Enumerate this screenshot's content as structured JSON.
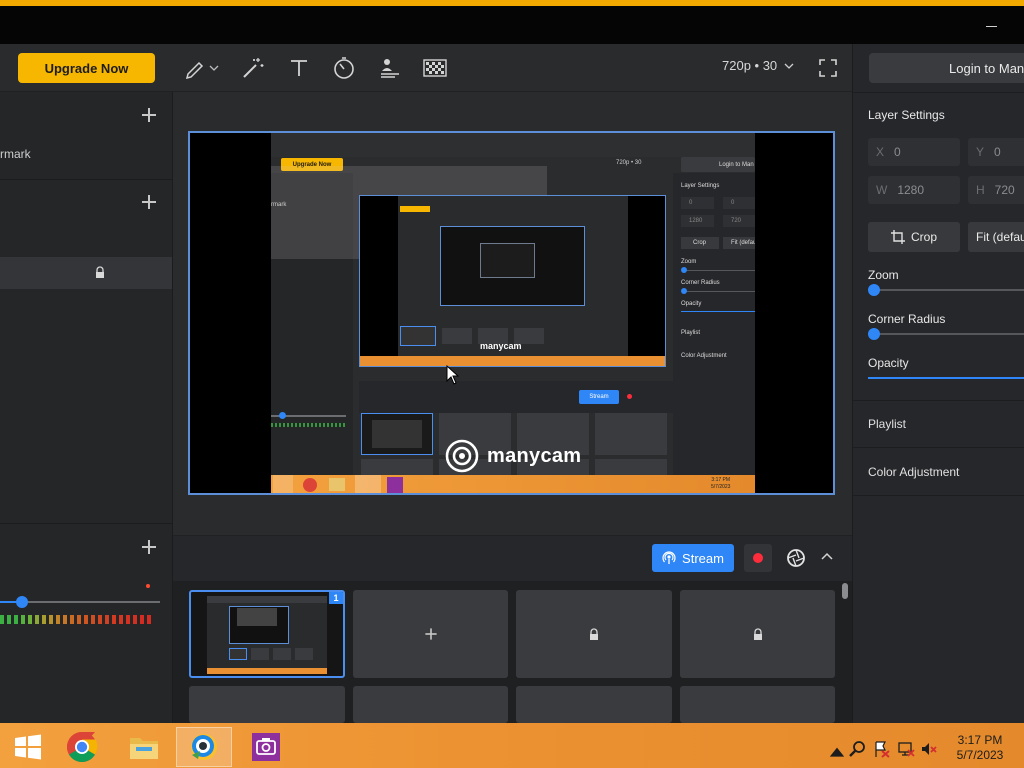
{
  "toolbar": {
    "upgrade_label": "Upgrade Now",
    "resolution_label": "720p • 30",
    "tools": [
      "pen-icon",
      "magic-wand-icon",
      "text-icon",
      "timer-icon",
      "lower-thirds-icon",
      "chroma-key-icon"
    ]
  },
  "left_panel": {
    "watermark_label": "rmark"
  },
  "preview": {
    "inner_upgrade_label": "Upgrade Now",
    "inner_login_label": "Login to Man",
    "inner_layer_settings": "Layer Settings",
    "inner_zoom": "Zoom",
    "inner_corner": "Corner Radius",
    "inner_opacity": "Opacity",
    "inner_playlist": "Playlist",
    "inner_color": "Color Adjustment",
    "inner_crop": "Crop",
    "inner_fit": "Fit (defau",
    "inner_stream": "Stream",
    "inner_resolution": "720p • 30",
    "inner_x": "0",
    "inner_y": "0",
    "inner_w": "1280",
    "inner_h": "720",
    "watermark_text": "manycam",
    "inner_clock_time": "3:17 PM",
    "inner_clock_date": "5/7/2023",
    "inner_watermark_label": "rmark"
  },
  "controls": {
    "stream_label": "Stream"
  },
  "scenes": {
    "active_badge": "1",
    "tiles": [
      {
        "state": "active"
      },
      {
        "state": "add"
      },
      {
        "state": "locked"
      },
      {
        "state": "locked"
      }
    ]
  },
  "right_panel": {
    "login_label": "Login to Many",
    "layer_settings_title": "Layer Settings",
    "x_key": "X",
    "x_value": "0",
    "y_key": "Y",
    "y_value": "0",
    "w_key": "W",
    "w_value": "1280",
    "h_key": "H",
    "h_value": "720",
    "crop_label": "Crop",
    "fit_label": "Fit (defau",
    "zoom_label": "Zoom",
    "corner_radius_label": "Corner Radius",
    "opacity_label": "Opacity",
    "playlist_label": "Playlist",
    "color_adjustment_label": "Color Adjustment"
  },
  "taskbar": {
    "clock_time": "3:17 PM",
    "clock_date": "5/7/2023",
    "apps": [
      "windows-start-icon",
      "chrome-icon",
      "file-explorer-icon",
      "manycam-app-icon",
      "camera-app-icon"
    ]
  },
  "colors": {
    "accent": "#2f86f6",
    "upgrade": "#f7b600",
    "record": "#ff2d3b",
    "taskbar": "#ec9232"
  }
}
